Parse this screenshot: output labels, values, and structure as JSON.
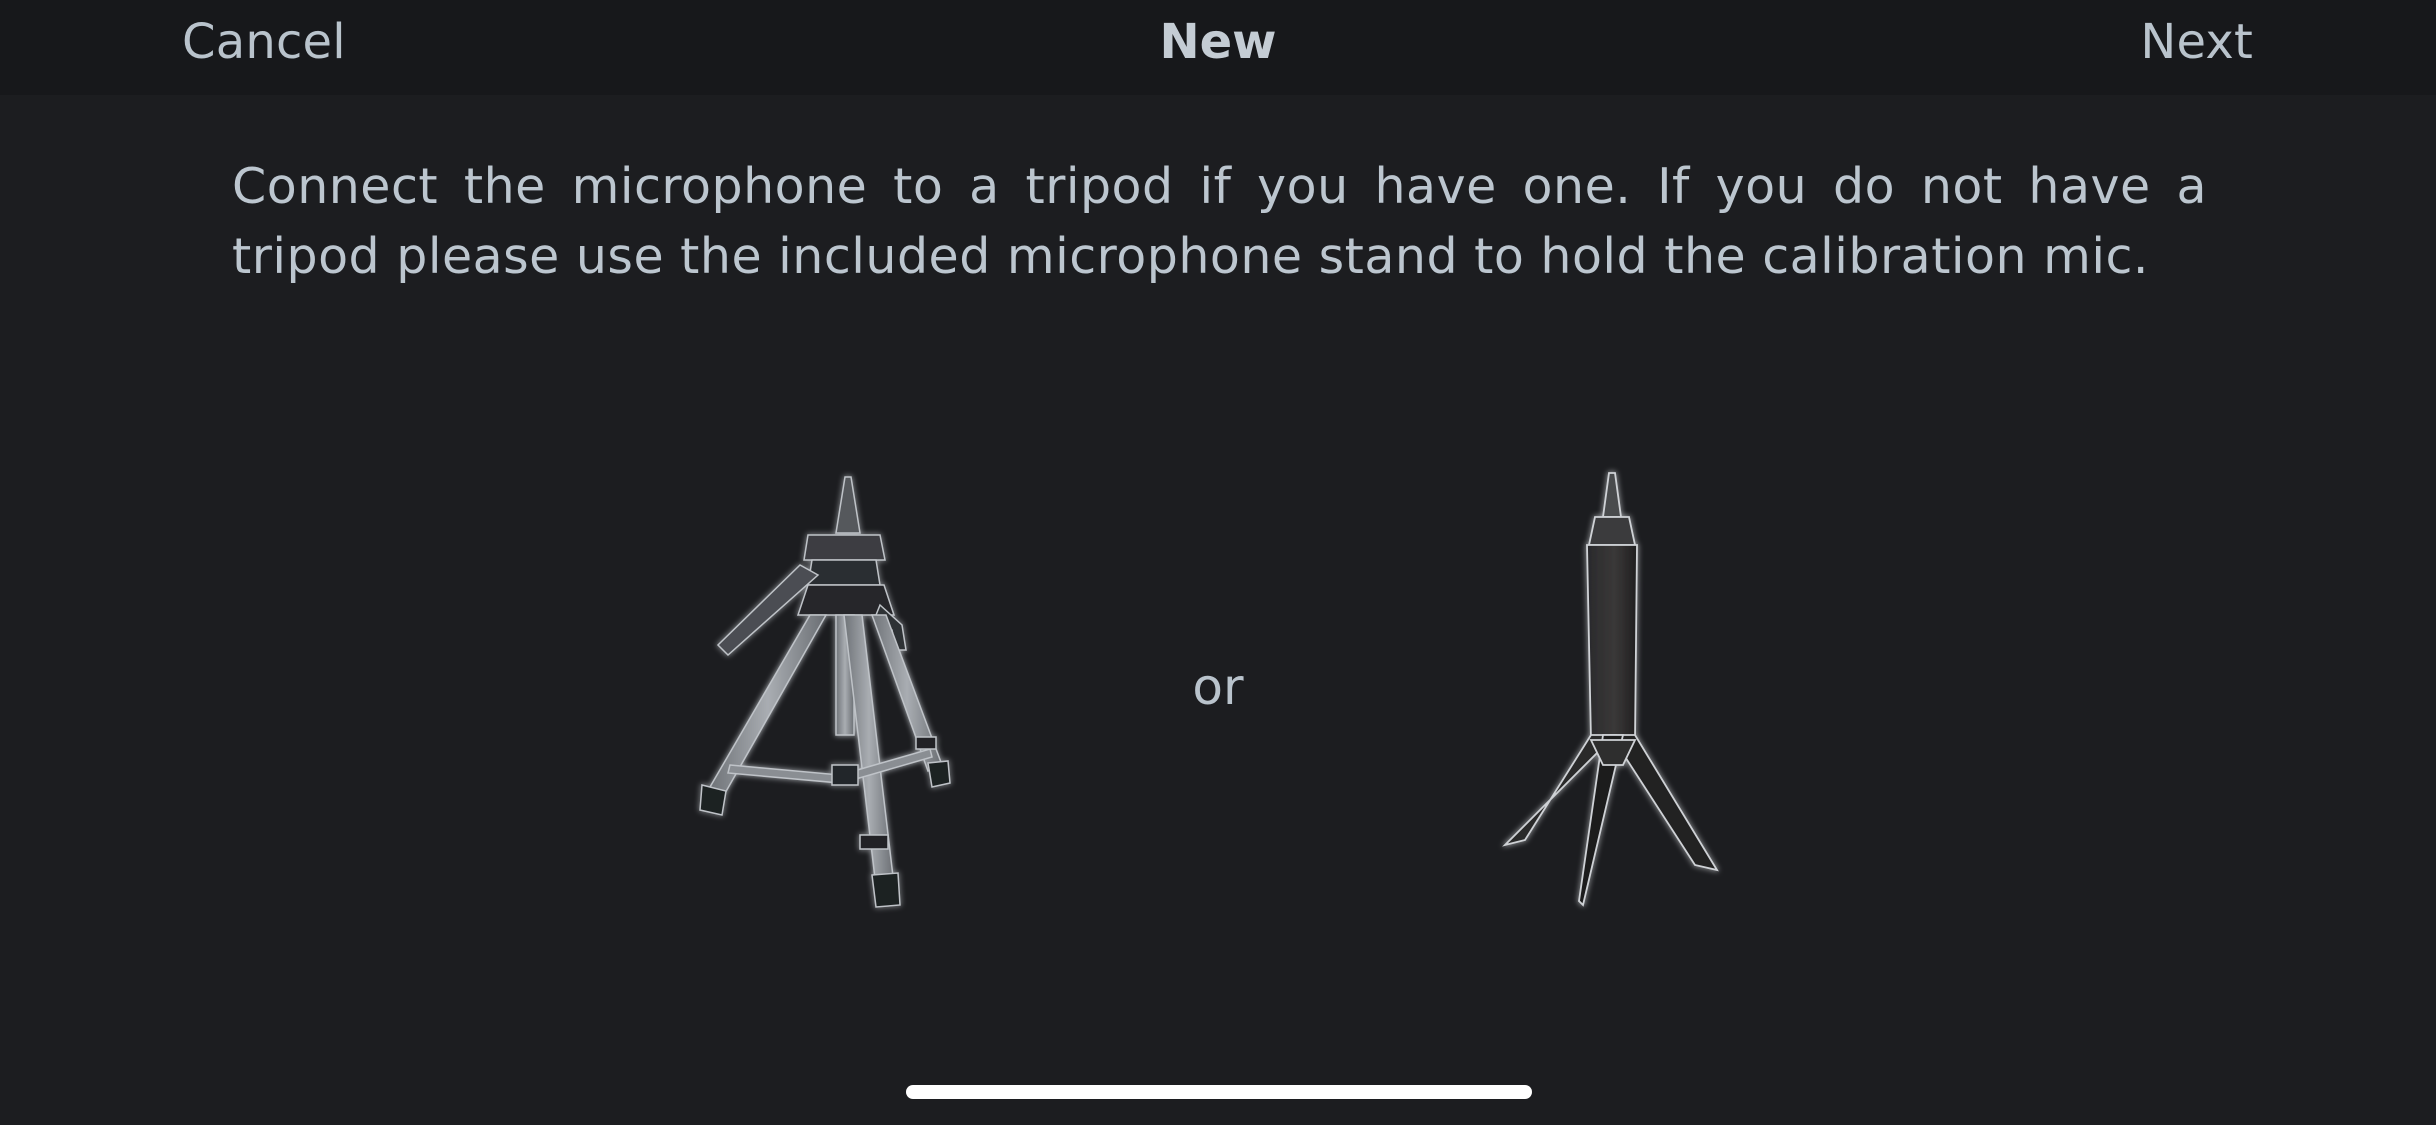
{
  "navbar": {
    "cancel_label": "Cancel",
    "title": "New",
    "next_label": "Next"
  },
  "instructions": "Connect the microphone to a tripod if you have one. If you do not have a tripod please use the included microphone stand to hold the calibration mic.",
  "separator": "or",
  "images": {
    "left": "tripod-with-microphone",
    "right": "microphone-stand"
  },
  "colors": {
    "background": "#1c1d20",
    "navbar_background": "#17181b",
    "text": "#bcc6cf"
  }
}
